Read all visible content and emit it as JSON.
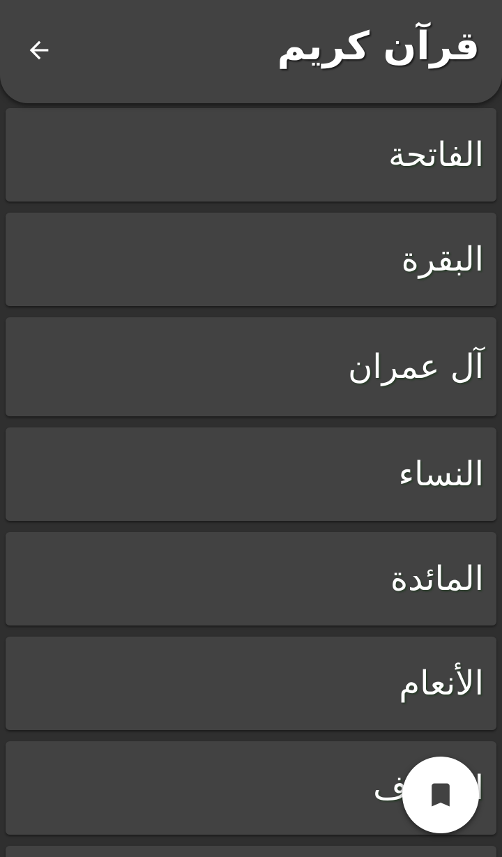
{
  "app_bar": {
    "title": "قرآن كريم",
    "back_icon": "arrow-back-icon"
  },
  "surahs": [
    {
      "name": "الفاتحة"
    },
    {
      "name": "البقرة"
    },
    {
      "name": "آل عمران"
    },
    {
      "name": "النساء"
    },
    {
      "name": "المائدة"
    },
    {
      "name": "الأنعام"
    },
    {
      "name": "الأعراف"
    }
  ],
  "fab": {
    "icon": "bookmark-icon"
  },
  "colors": {
    "background": "#2f2f2f",
    "surface": "#424242",
    "text": "#ffffff",
    "fab": "#ffffff",
    "fab_icon": "#424242"
  }
}
